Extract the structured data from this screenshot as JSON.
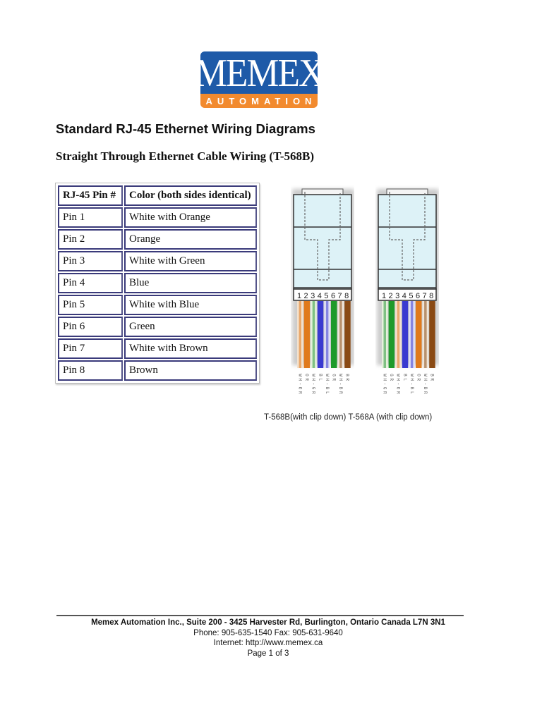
{
  "logo": {
    "top": "MEMEX",
    "bottom": "AUTOMATION",
    "colors": {
      "blue": "#1e5aa8",
      "orange": "#f28a2e"
    }
  },
  "title": "Standard RJ-45 Ethernet Wiring Diagrams",
  "subtitle": "Straight Through Ethernet Cable Wiring (T-568B)",
  "table": {
    "headers": [
      "RJ-45 Pin #",
      "Color (both sides identical)"
    ],
    "rows": [
      [
        "Pin 1",
        "White with Orange"
      ],
      [
        "Pin 2",
        "Orange"
      ],
      [
        "Pin 3",
        "White with Green"
      ],
      [
        "Pin 4",
        "Blue"
      ],
      [
        "Pin 5",
        "White with Blue"
      ],
      [
        "Pin 6",
        "Green"
      ],
      [
        "Pin 7",
        "White with Brown"
      ],
      [
        "Pin 8",
        "Brown"
      ]
    ]
  },
  "diagrams": [
    {
      "name": "T-568B",
      "pin_numbers": "12345678",
      "wires": [
        {
          "code": "WH-OR",
          "base": "#f3e2cf",
          "stripe": "#e07a1c"
        },
        {
          "code": "OR",
          "base": "#e07a1c",
          "stripe": null
        },
        {
          "code": "WH-GR",
          "base": "#e6f0dc",
          "stripe": "#2a9a3a"
        },
        {
          "code": "BL",
          "base": "#3a3ad0",
          "stripe": null
        },
        {
          "code": "WH-BL",
          "base": "#e0e0f6",
          "stripe": "#3a3ad0"
        },
        {
          "code": "GR",
          "base": "#1e9a2a",
          "stripe": null
        },
        {
          "code": "WH-BR",
          "base": "#f0e6da",
          "stripe": "#8a4a14"
        },
        {
          "code": "BR",
          "base": "#8a4a14",
          "stripe": null
        }
      ]
    },
    {
      "name": "T-568A",
      "pin_numbers": "12345678",
      "wires": [
        {
          "code": "WH-GR",
          "base": "#e6f0dc",
          "stripe": "#2a9a3a"
        },
        {
          "code": "GR",
          "base": "#1e9a2a",
          "stripe": null
        },
        {
          "code": "WH-OR",
          "base": "#f3e2cf",
          "stripe": "#e07a1c"
        },
        {
          "code": "BL",
          "base": "#3a3ad0",
          "stripe": null
        },
        {
          "code": "WH-BL",
          "base": "#e0e0f6",
          "stripe": "#3a3ad0"
        },
        {
          "code": "OR",
          "base": "#e07a1c",
          "stripe": null
        },
        {
          "code": "WH-BR",
          "base": "#f0e6da",
          "stripe": "#8a4a14"
        },
        {
          "code": "BR",
          "base": "#8a4a14",
          "stripe": null
        }
      ]
    }
  ],
  "diagram_caption": "T-568B(with clip down) T-568A (with clip down)",
  "footer": {
    "address": "Memex Automation Inc., Suite 200 - 3425 Harvester Rd, Burlington, Ontario  Canada L7N 3N1",
    "phone": "Phone: 905-635-1540 Fax: 905-631-9640",
    "internet": "Internet: http://www.memex.ca",
    "page": "Page 1 of 3"
  }
}
